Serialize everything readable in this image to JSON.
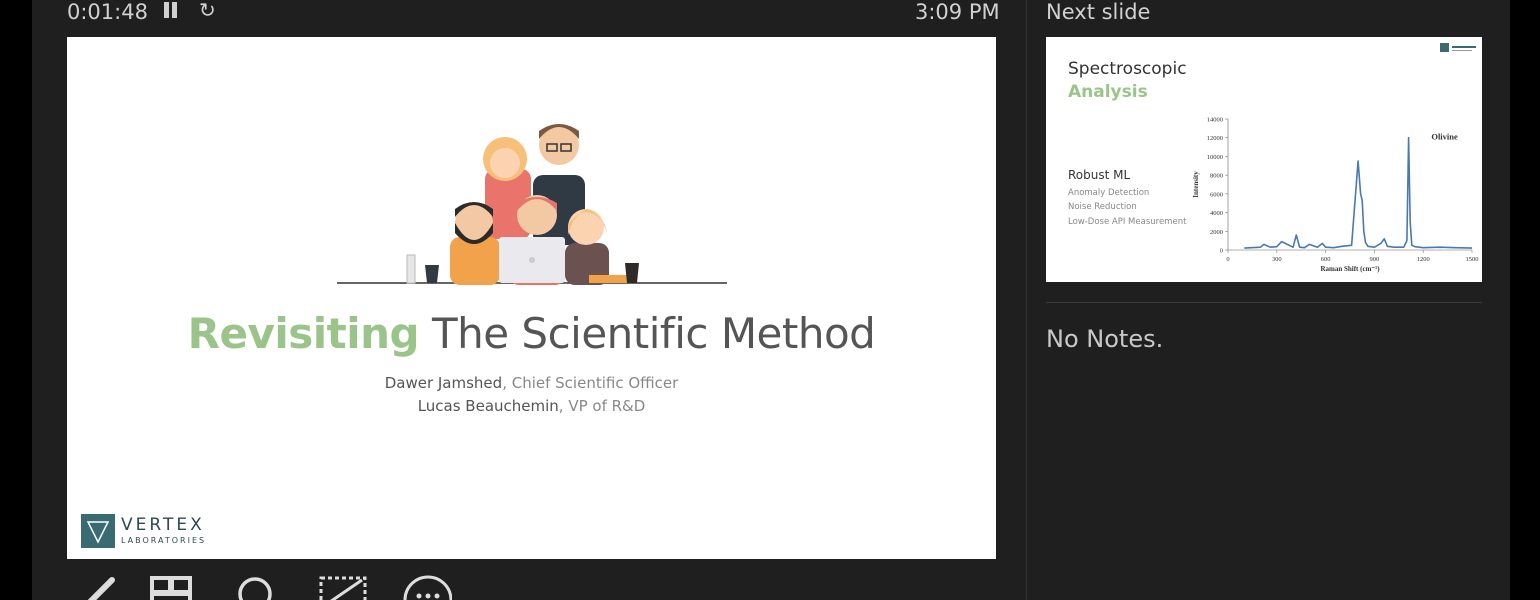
{
  "header": {
    "timer": "0:01:48",
    "clock": "3:09 PM",
    "next_slide_label": "Next slide"
  },
  "current_slide": {
    "title_accent": "Revisiting",
    "title_rest": " The Scientific Method",
    "presenters": [
      {
        "name": "Dawer Jamshed",
        "role": ", Chief Scientific Officer"
      },
      {
        "name": "Lucas Beauchemin",
        "role": ", VP of R&D"
      }
    ],
    "logo_name": "VERTEX",
    "logo_sub": "LABORATORIES"
  },
  "next_slide": {
    "title_line1": "Spectroscopic",
    "title_line2": "Analysis",
    "subtitle": "Robust ML",
    "items": [
      "Anomaly Detection",
      "Noise Reduction",
      "Low-Dose API Measurement"
    ],
    "logo_name": "VERTEX"
  },
  "notes": "No Notes.",
  "icons": [
    "pause-icon",
    "restart-icon",
    "pen-icon",
    "slides-grid-icon",
    "zoom-icon",
    "blackout-icon",
    "more-icon"
  ],
  "colors": {
    "accent_green": "#9bc48a",
    "brand_teal": "#3a6b72",
    "panel_bg": "#1f1f1f"
  },
  "chart_data": {
    "type": "line",
    "xlabel": "Raman Shift (cm⁻¹)",
    "ylabel": "Intensity",
    "xlim": [
      0,
      1500
    ],
    "ylim": [
      0,
      14000
    ],
    "xticks": [
      0,
      300,
      600,
      900,
      1200,
      1500
    ],
    "yticks": [
      0,
      2000,
      4000,
      6000,
      8000,
      10000,
      12000,
      14000
    ],
    "annotation": "Olivine",
    "series": [
      {
        "x": [
          100,
          200,
          220,
          260,
          300,
          330,
          400,
          420,
          440,
          470,
          500,
          550,
          580,
          600,
          650,
          700,
          760,
          800,
          815,
          825,
          835,
          845,
          860,
          900,
          940,
          960,
          980,
          1020,
          1080,
          1100,
          1110,
          1120,
          1130,
          1150,
          1200,
          1300,
          1400,
          1500
        ],
        "y": [
          200,
          300,
          600,
          300,
          350,
          900,
          300,
          1600,
          300,
          250,
          600,
          300,
          700,
          300,
          250,
          400,
          500,
          9500,
          6000,
          5300,
          2000,
          800,
          400,
          300,
          700,
          1200,
          400,
          300,
          300,
          1000,
          12000,
          3000,
          500,
          350,
          250,
          300,
          250,
          200
        ]
      }
    ]
  }
}
